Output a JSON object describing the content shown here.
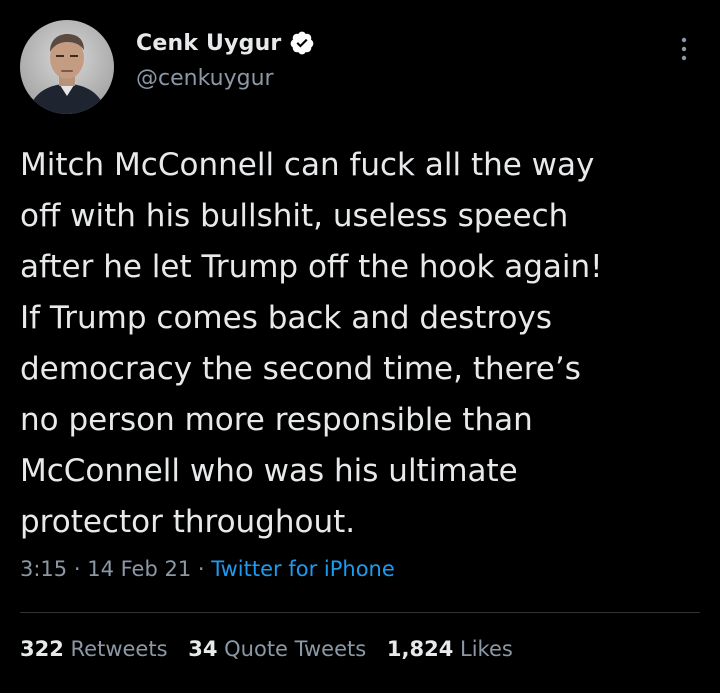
{
  "tweet": {
    "author": {
      "display_name": "Cenk Uygur",
      "handle": "@cenkuygur",
      "verified": true,
      "avatar_icon": "profile-photo"
    },
    "text": "Mitch McConnell can fuck all the way\noff with his bullshit, useless speech\nafter he let Trump off the hook again!\nIf Trump comes back and destroys\ndemocracy the second time, there’s\nno person more responsible than\nMcConnell who was his ultimate\nprotector throughout.",
    "time": "3:15",
    "separator": "·",
    "date": "14 Feb 21",
    "source": "Twitter for iPhone",
    "stats": {
      "retweets_count": "322",
      "retweets_label": "Retweets",
      "quote_count": "34",
      "quote_label": "Quote Tweets",
      "likes_count": "1,824",
      "likes_label": "Likes"
    }
  },
  "colors": {
    "background": "#000000",
    "primary_text": "#e7e9ea",
    "secondary_text": "#8b98a5",
    "link": "#1d9bf0",
    "divider": "#2f3336"
  }
}
